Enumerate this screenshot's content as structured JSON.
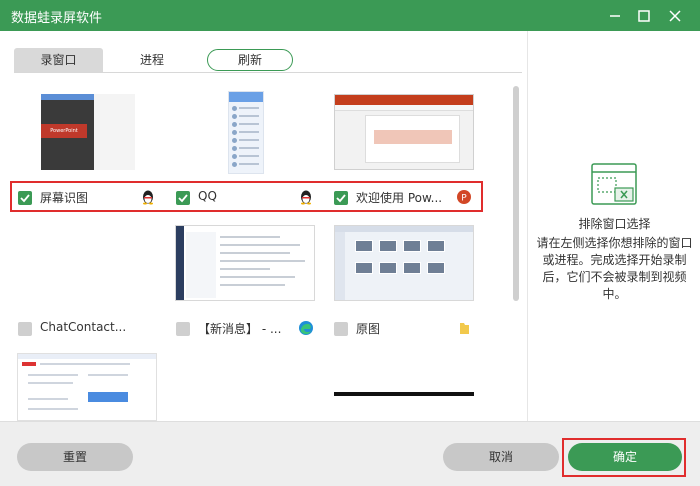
{
  "window": {
    "title": "数据蛙录屏软件"
  },
  "tabs": {
    "record_window": "录窗口",
    "process": "进程",
    "refresh": "刷新"
  },
  "items": [
    {
      "label": "屏幕识图",
      "checked": true,
      "icon": "qq-penguin-icon"
    },
    {
      "label": "QQ",
      "checked": true,
      "icon": "qq-penguin-icon"
    },
    {
      "label": "欢迎使用 Pow...",
      "checked": true,
      "icon": "powerpoint-icon"
    },
    {
      "label": "ChatContact...",
      "checked": false,
      "icon": ""
    },
    {
      "label": "【新消息】 - ...",
      "checked": false,
      "icon": "edge-icon"
    },
    {
      "label": "原图",
      "checked": false,
      "icon": "folder-icon"
    }
  ],
  "thumbnail_text": {
    "ppt_dark": "PowerPoint"
  },
  "exclude_panel": {
    "title": "排除窗口选择",
    "description": "请在左侧选择你想排除的窗口或进程。完成选择开始录制后，它们不会被录制到视频中。"
  },
  "buttons": {
    "reset": "重置",
    "cancel": "取消",
    "ok": "确定"
  },
  "colors": {
    "accent": "#3b9a55",
    "highlight": "#e02d2d"
  }
}
